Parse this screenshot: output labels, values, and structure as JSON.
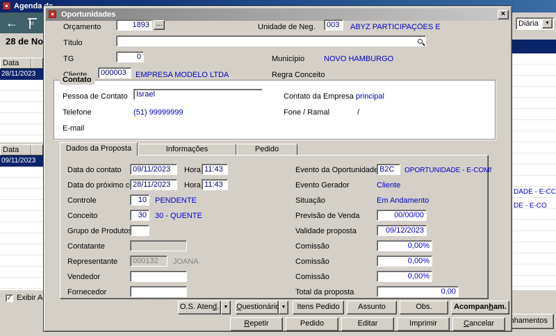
{
  "colors": {
    "accent_blue": "#0000cc",
    "entry_navy": "#000080",
    "selection_navy": "#0a246a",
    "toolbar_teal": "#40606a",
    "window_gray": "#d4d0c8"
  },
  "icons": {
    "back_arrow": "←",
    "dropdown_arrow": "▼",
    "close": "×",
    "checkmark": "✓"
  },
  "window": {
    "title": "Agenda de",
    "view_dropdown_value": "Diária",
    "date_heading": "28 de Nov",
    "agenda_list_top": {
      "header": "Data",
      "selected_date": "28/11/2023"
    },
    "agenda_list_bottom": {
      "header": "Data",
      "selected_date": "09/11/2023"
    },
    "right_text_fragments": {
      "line1": "DADE - E-CO",
      "line2": "DE - E-CO"
    },
    "show_checkbox_label": "Exibir Acom",
    "bottom_right_button_fragment": "nhamentos"
  },
  "dialog": {
    "title": "Oportunidades",
    "header": {
      "orcamento_label": "Orçamento",
      "orcamento_value": "1893",
      "browse_button": "...",
      "unidade_label": "Unidade de Neg.",
      "unidade_code": "003",
      "unidade_name": "ABYZ PARTICIPAÇÕES E",
      "titulo_label": "Título",
      "titulo_value": "",
      "tg_label": "TG",
      "tg_value": "0",
      "municipio_label": "Município",
      "municipio_value": "NOVO HAMBURGO",
      "cliente_label": "Cliente",
      "cliente_code": "000003",
      "cliente_name": "EMPRESA MODELO LTDA",
      "regra_conceito_label": "Regra Conceito"
    },
    "contato": {
      "group_title": "Contato",
      "pessoa_label": "Pessoa de Contato",
      "pessoa_value": "Israel",
      "contato_empresa_label": "Contato da Empresa",
      "contato_empresa_value": "principal",
      "telefone_label": "Telefone",
      "telefone_value": "(51) 99999999",
      "fone_ramal_label": "Fone / Ramal",
      "fone_ramal_value": "/",
      "email_label": "E-mail"
    },
    "tabs": {
      "tab1": "Dados da Proposta",
      "tab2": "Informações Complementares",
      "tab3": "Pedido"
    },
    "proposta": {
      "data_contato_label": "Data do contato",
      "data_contato_value": "09/11/2023",
      "hora_label": "Hora",
      "hora_contato_value": "11:43",
      "data_proximo_label": "Data do próximo contato",
      "data_proximo_value": "28/11/2023",
      "hora_proximo_value": "11:43",
      "controle_label": "Controle",
      "controle_code": "10",
      "controle_desc": "PENDENTE",
      "conceito_label": "Conceito",
      "conceito_code": "30",
      "conceito_desc": "30 - QUENTE",
      "grupo_label": "Grupo de Produtos",
      "grupo_value": "",
      "contatante_label": "Contatante",
      "contatante_value": "",
      "representante_label": "Representante",
      "representante_code": "000132",
      "representante_name": "JOANA",
      "vendedor_label": "Vendedor",
      "vendedor_value": "",
      "fornecedor_label": "Fornecedor",
      "fornecedor_value": "",
      "evento_label": "Evento da Oportunidade",
      "evento_code": "B2C",
      "evento_desc": "OPORTUNIDADE - E-COMMERCE",
      "evento_gerador_label": "Evento Gerador",
      "evento_gerador_value": "Cliente",
      "situacao_label": "Situação",
      "situacao_value": "Em Andamento",
      "previsao_label": "Previsão de Venda",
      "previsao_value": "00/00/00",
      "validade_label": "Validade proposta",
      "validade_value": "09/12/2023",
      "comissao1_label": "Comissão",
      "comissao1_value": "0,00%",
      "comissao2_label": "Comissão",
      "comissao2_value": "0,00%",
      "comissao3_label": "Comissão",
      "comissao3_value": "0,00%",
      "total_label": "Total da proposta",
      "total_value": "0,00"
    },
    "actions": {
      "os_atend": {
        "pre": "O.S. Aten",
        "key": "d",
        "post": "."
      },
      "questionario": {
        "pre": "",
        "key": "Q",
        "post": "uestionário"
      },
      "itens_pedido": {
        "pre": "Itens Pedido",
        "key": "",
        "post": ""
      },
      "assunto": {
        "pre": "Assunto",
        "key": "",
        "post": ""
      },
      "obs": {
        "pre": "Obs.",
        "key": "",
        "post": ""
      },
      "acompanham": {
        "pre": "Acompan",
        "key": "h",
        "post": "am."
      },
      "repetir": {
        "pre": "",
        "key": "R",
        "post": "epetir"
      },
      "pedido": {
        "pre": "Pedido",
        "key": "",
        "post": ""
      },
      "editar": {
        "pre": "Editar",
        "key": "",
        "post": ""
      },
      "imprimir": {
        "pre": "Imprimir",
        "key": "",
        "post": ""
      },
      "cancelar": {
        "pre": "",
        "key": "C",
        "post": "ancelar"
      }
    }
  }
}
